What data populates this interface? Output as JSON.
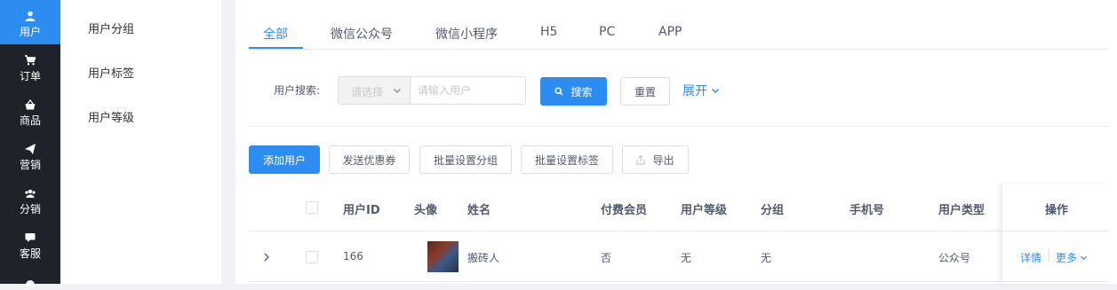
{
  "nav": {
    "items": [
      {
        "label": "用户",
        "icon": "user-icon"
      },
      {
        "label": "订单",
        "icon": "cart-icon"
      },
      {
        "label": "商品",
        "icon": "basket-icon"
      },
      {
        "label": "营销",
        "icon": "send-icon"
      },
      {
        "label": "分销",
        "icon": "group-icon"
      },
      {
        "label": "客服",
        "icon": "chat-icon"
      }
    ]
  },
  "submenu": {
    "items": [
      "用户分组",
      "用户标签",
      "用户等级"
    ]
  },
  "tabs": [
    "全部",
    "微信公众号",
    "微信小程序",
    "H5",
    "PC",
    "APP"
  ],
  "search": {
    "label": "用户搜索:",
    "select_placeholder": "请选择",
    "input_placeholder": "请输入用户",
    "search_button": "搜索",
    "reset_button": "重置",
    "expand": "展开"
  },
  "toolbar": {
    "add_user": "添加用户",
    "send_coupon": "发送优惠券",
    "batch_group": "批量设置分组",
    "batch_tag": "批量设置标签",
    "export": "导出"
  },
  "table": {
    "headers": [
      "用户ID",
      "头像",
      "姓名",
      "付费会员",
      "用户等级",
      "分组",
      "手机号",
      "用户类型",
      "操作"
    ],
    "rows": [
      {
        "id": "166",
        "name": "搬砖人",
        "paid_member": "否",
        "level": "无",
        "group": "无",
        "phone": "",
        "type": "公众号",
        "detail": "详情",
        "more": "更多"
      }
    ]
  },
  "colors": {
    "accent": "#2d8cf0",
    "nav_bg": "#1f2329"
  }
}
